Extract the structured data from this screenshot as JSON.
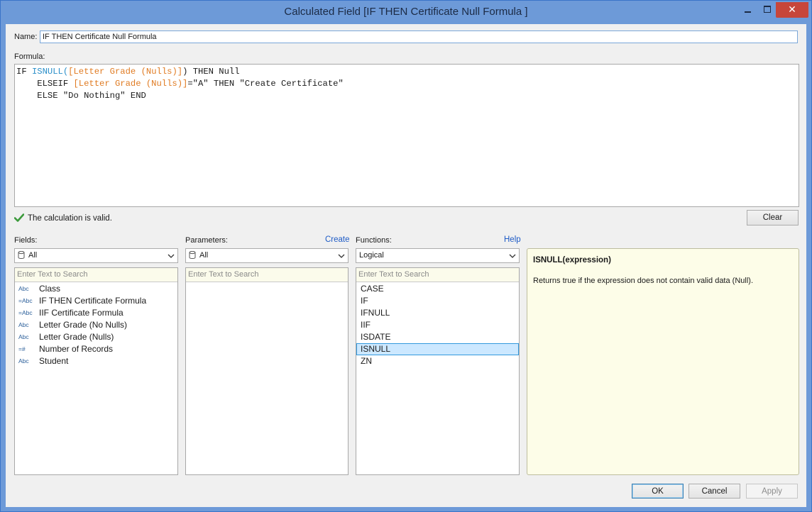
{
  "window": {
    "title": "Calculated Field [IF THEN Certificate Null Formula ]",
    "close_glyph": "✕"
  },
  "name_label": "Name:",
  "name_value": "IF THEN Certificate Null Formula",
  "formula_label": "Formula:",
  "formula": {
    "l1_if": "IF ",
    "l1_fn": "ISNULL",
    "l1_open": "(",
    "l1_field": "[Letter Grade (Nulls)]",
    "l1_rest": ") THEN Null",
    "l2_kw": "    ELSEIF ",
    "l2_field": "[Letter Grade (Nulls)]",
    "l2_rest": "=\"A\" THEN \"Create Certificate\"",
    "l3": "    ELSE \"Do Nothing\" END"
  },
  "status_text": "The calculation is valid.",
  "clear_label": "Clear",
  "fields": {
    "label": "Fields:",
    "dropdown_value": "All",
    "search_placeholder": "Enter Text to Search",
    "items": [
      {
        "type": "Abc",
        "name": "Class"
      },
      {
        "type": "=Abc",
        "name": "IF THEN Certificate Formula"
      },
      {
        "type": "=Abc",
        "name": "IIF Certificate Formula"
      },
      {
        "type": "Abc",
        "name": "Letter Grade (No Nulls)"
      },
      {
        "type": "Abc",
        "name": "Letter Grade (Nulls)"
      },
      {
        "type": "=#",
        "name": "Number of Records"
      },
      {
        "type": "Abc",
        "name": "Student"
      }
    ]
  },
  "parameters": {
    "label": "Parameters:",
    "create_link": "Create",
    "dropdown_value": "All",
    "search_placeholder": "Enter Text to Search"
  },
  "functions": {
    "label": "Functions:",
    "help_link": "Help",
    "dropdown_value": "Logical",
    "search_placeholder": "Enter Text to Search",
    "items": [
      "CASE",
      "IF",
      "IFNULL",
      "IIF",
      "ISDATE",
      "ISNULL",
      "ZN"
    ],
    "selected": "ISNULL"
  },
  "doc": {
    "title": "ISNULL(expression)",
    "description": "Returns true if the expression does not contain valid data (Null)."
  },
  "buttons": {
    "ok": "OK",
    "cancel": "Cancel",
    "apply": "Apply"
  },
  "colors": {
    "titlebar": "#6d9ad8",
    "function_keyword": "#2b8fc9",
    "field_reference": "#e07b22",
    "link": "#1e5bc6",
    "valid_check": "#3c9a3c"
  }
}
